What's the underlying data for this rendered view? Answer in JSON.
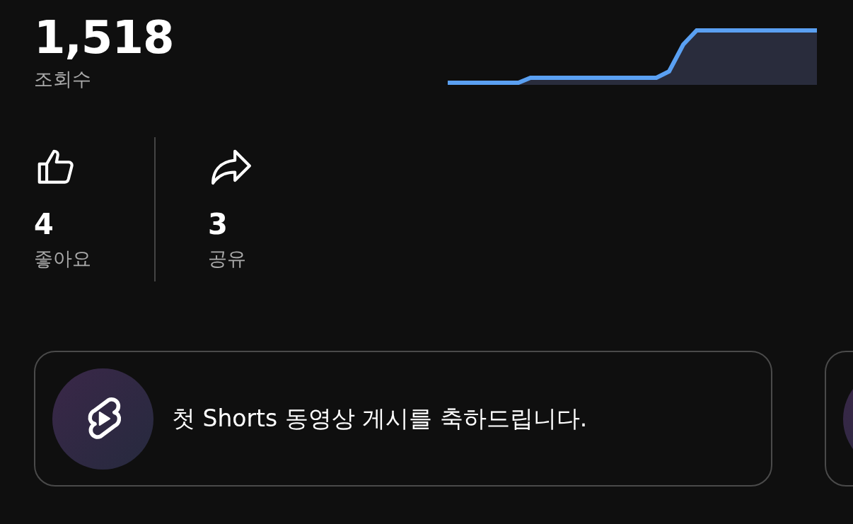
{
  "views": {
    "value": "1,518",
    "label": "조회수"
  },
  "stats": [
    {
      "kind": "like",
      "value": "4",
      "label": "좋아요"
    },
    {
      "kind": "share",
      "value": "3",
      "label": "공유"
    }
  ],
  "cards": [
    {
      "kind": "achievement",
      "text": "첫 Shorts 동영상 게시를 축하드립니다."
    },
    {
      "kind": "achievement"
    }
  ]
}
